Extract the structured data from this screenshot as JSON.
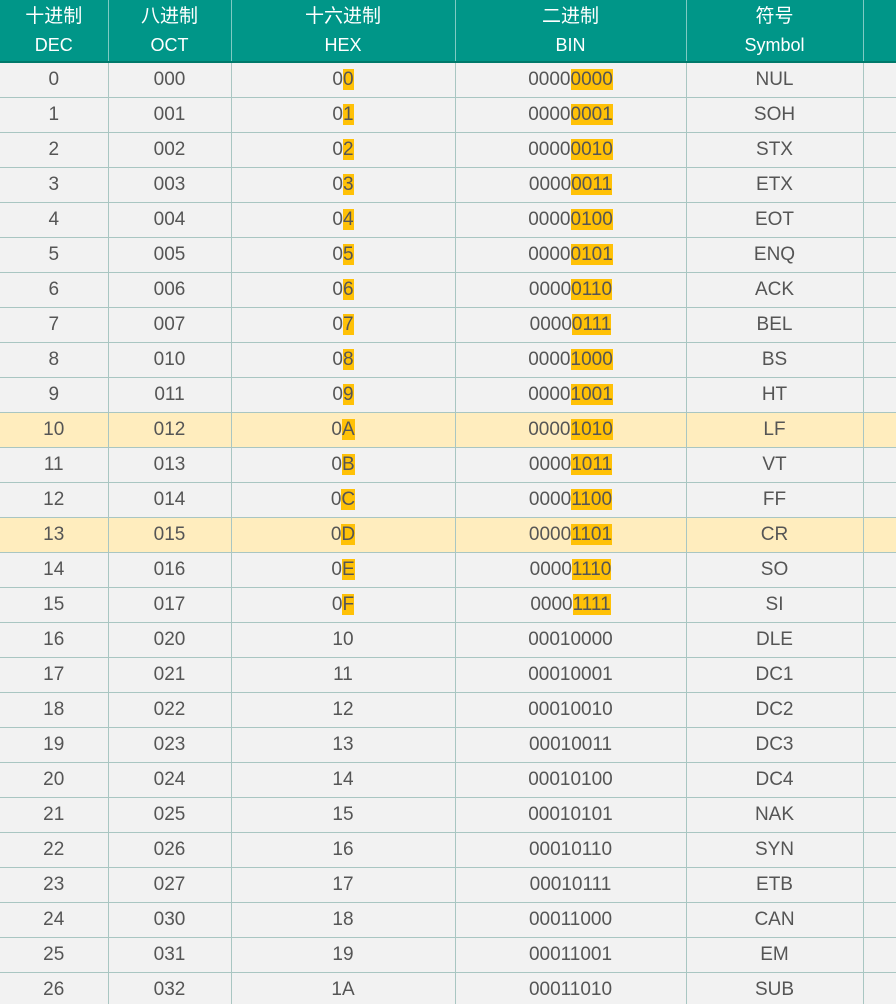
{
  "header": {
    "dec": {
      "zh": "十进制",
      "en": "DEC"
    },
    "oct": {
      "zh": "八进制",
      "en": "OCT"
    },
    "hex": {
      "zh": "十六进制",
      "en": "HEX"
    },
    "bin": {
      "zh": "二进制",
      "en": "BIN"
    },
    "sym": {
      "zh": "符号",
      "en": "Symbol"
    }
  },
  "colors": {
    "header_bg": "#009688",
    "highlight_row": "#ffedbe",
    "highlight_text": "#ffc107",
    "body_bg": "#f2f2f2"
  },
  "rows": [
    {
      "dec": "0",
      "oct": "000",
      "hex_a": "0",
      "hex_b": "0",
      "bin_a": "0000",
      "bin_b": "0000",
      "sym": "NUL",
      "highlight": false,
      "mark": true
    },
    {
      "dec": "1",
      "oct": "001",
      "hex_a": "0",
      "hex_b": "1",
      "bin_a": "0000",
      "bin_b": "0001",
      "sym": "SOH",
      "highlight": false,
      "mark": true
    },
    {
      "dec": "2",
      "oct": "002",
      "hex_a": "0",
      "hex_b": "2",
      "bin_a": "0000",
      "bin_b": "0010",
      "sym": "STX",
      "highlight": false,
      "mark": true
    },
    {
      "dec": "3",
      "oct": "003",
      "hex_a": "0",
      "hex_b": "3",
      "bin_a": "0000",
      "bin_b": "0011",
      "sym": "ETX",
      "highlight": false,
      "mark": true
    },
    {
      "dec": "4",
      "oct": "004",
      "hex_a": "0",
      "hex_b": "4",
      "bin_a": "0000",
      "bin_b": "0100",
      "sym": "EOT",
      "highlight": false,
      "mark": true
    },
    {
      "dec": "5",
      "oct": "005",
      "hex_a": "0",
      "hex_b": "5",
      "bin_a": "0000",
      "bin_b": "0101",
      "sym": "ENQ",
      "highlight": false,
      "mark": true
    },
    {
      "dec": "6",
      "oct": "006",
      "hex_a": "0",
      "hex_b": "6",
      "bin_a": "0000",
      "bin_b": "0110",
      "sym": "ACK",
      "highlight": false,
      "mark": true
    },
    {
      "dec": "7",
      "oct": "007",
      "hex_a": "0",
      "hex_b": "7",
      "bin_a": "0000",
      "bin_b": "0111",
      "sym": "BEL",
      "highlight": false,
      "mark": true
    },
    {
      "dec": "8",
      "oct": "010",
      "hex_a": "0",
      "hex_b": "8",
      "bin_a": "0000",
      "bin_b": "1000",
      "sym": "BS",
      "highlight": false,
      "mark": true
    },
    {
      "dec": "9",
      "oct": "011",
      "hex_a": "0",
      "hex_b": "9",
      "bin_a": "0000",
      "bin_b": "1001",
      "sym": "HT",
      "highlight": false,
      "mark": true
    },
    {
      "dec": "10",
      "oct": "012",
      "hex_a": "0",
      "hex_b": "A",
      "bin_a": "0000",
      "bin_b": "1010",
      "sym": "LF",
      "highlight": true,
      "mark": true
    },
    {
      "dec": "11",
      "oct": "013",
      "hex_a": "0",
      "hex_b": "B",
      "bin_a": "0000",
      "bin_b": "1011",
      "sym": "VT",
      "highlight": false,
      "mark": true
    },
    {
      "dec": "12",
      "oct": "014",
      "hex_a": "0",
      "hex_b": "C",
      "bin_a": "0000",
      "bin_b": "1100",
      "sym": "FF",
      "highlight": false,
      "mark": true
    },
    {
      "dec": "13",
      "oct": "015",
      "hex_a": "0",
      "hex_b": "D",
      "bin_a": "0000",
      "bin_b": "1101",
      "sym": "CR",
      "highlight": true,
      "mark": true
    },
    {
      "dec": "14",
      "oct": "016",
      "hex_a": "0",
      "hex_b": "E",
      "bin_a": "0000",
      "bin_b": "1110",
      "sym": "SO",
      "highlight": false,
      "mark": true
    },
    {
      "dec": "15",
      "oct": "017",
      "hex_a": "0",
      "hex_b": "F",
      "bin_a": "0000",
      "bin_b": "1111",
      "sym": "SI",
      "highlight": false,
      "mark": true
    },
    {
      "dec": "16",
      "oct": "020",
      "hex_a": "10",
      "hex_b": "",
      "bin_a": "00010000",
      "bin_b": "",
      "sym": "DLE",
      "highlight": false,
      "mark": false
    },
    {
      "dec": "17",
      "oct": "021",
      "hex_a": "11",
      "hex_b": "",
      "bin_a": "00010001",
      "bin_b": "",
      "sym": "DC1",
      "highlight": false,
      "mark": false
    },
    {
      "dec": "18",
      "oct": "022",
      "hex_a": "12",
      "hex_b": "",
      "bin_a": "00010010",
      "bin_b": "",
      "sym": "DC2",
      "highlight": false,
      "mark": false
    },
    {
      "dec": "19",
      "oct": "023",
      "hex_a": "13",
      "hex_b": "",
      "bin_a": "00010011",
      "bin_b": "",
      "sym": "DC3",
      "highlight": false,
      "mark": false
    },
    {
      "dec": "20",
      "oct": "024",
      "hex_a": "14",
      "hex_b": "",
      "bin_a": "00010100",
      "bin_b": "",
      "sym": "DC4",
      "highlight": false,
      "mark": false
    },
    {
      "dec": "21",
      "oct": "025",
      "hex_a": "15",
      "hex_b": "",
      "bin_a": "00010101",
      "bin_b": "",
      "sym": "NAK",
      "highlight": false,
      "mark": false
    },
    {
      "dec": "22",
      "oct": "026",
      "hex_a": "16",
      "hex_b": "",
      "bin_a": "00010110",
      "bin_b": "",
      "sym": "SYN",
      "highlight": false,
      "mark": false
    },
    {
      "dec": "23",
      "oct": "027",
      "hex_a": "17",
      "hex_b": "",
      "bin_a": "00010111",
      "bin_b": "",
      "sym": "ETB",
      "highlight": false,
      "mark": false
    },
    {
      "dec": "24",
      "oct": "030",
      "hex_a": "18",
      "hex_b": "",
      "bin_a": "00011000",
      "bin_b": "",
      "sym": "CAN",
      "highlight": false,
      "mark": false
    },
    {
      "dec": "25",
      "oct": "031",
      "hex_a": "19",
      "hex_b": "",
      "bin_a": "00011001",
      "bin_b": "",
      "sym": "EM",
      "highlight": false,
      "mark": false
    },
    {
      "dec": "26",
      "oct": "032",
      "hex_a": "1A",
      "hex_b": "",
      "bin_a": "00011010",
      "bin_b": "",
      "sym": "SUB",
      "highlight": false,
      "mark": false
    }
  ]
}
